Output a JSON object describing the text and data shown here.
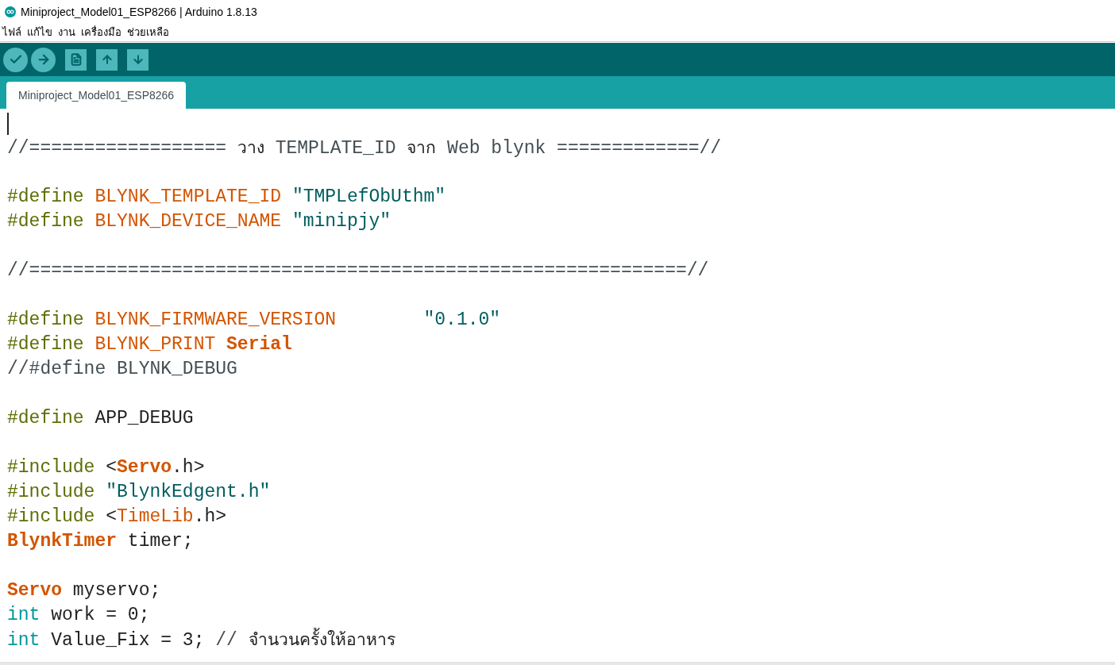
{
  "window": {
    "title": "Miniproject_Model01_ESP8266 | Arduino 1.8.13"
  },
  "menu": [
    "ไฟล์",
    "แก้ไข",
    "งาน",
    "เครื่องมือ",
    "ช่วยเหลือ"
  ],
  "toolbar": [
    {
      "kind": "verify"
    },
    {
      "kind": "upload"
    },
    {
      "kind": "new"
    },
    {
      "kind": "open"
    },
    {
      "kind": "save"
    }
  ],
  "tabs": [
    {
      "label": "Miniproject_Model01_ESP8266",
      "selected": true
    }
  ],
  "editor": {
    "lines": [
      {
        "kind": "blank"
      },
      {
        "kind": "code",
        "tokens": [
          {
            "kind": "comment",
            "text": "//================== "
          },
          {
            "kind": "thai",
            "text": "วาง"
          },
          {
            "kind": "comment",
            "text": " TEMPLATE_ID "
          },
          {
            "kind": "thai",
            "text": "จาก"
          },
          {
            "kind": "comment",
            "text": " Web blynk =============//"
          }
        ]
      },
      {
        "kind": "blank"
      },
      {
        "kind": "code",
        "tokens": [
          {
            "kind": "directive",
            "text": "#define "
          },
          {
            "kind": "macro",
            "text": "BLYNK_TEMPLATE_ID "
          },
          {
            "kind": "string",
            "text": "\"TMPLefObUthm\""
          }
        ]
      },
      {
        "kind": "code",
        "tokens": [
          {
            "kind": "directive",
            "text": "#define "
          },
          {
            "kind": "macro",
            "text": "BLYNK_DEVICE_NAME "
          },
          {
            "kind": "string",
            "text": "\"minipjy\""
          }
        ]
      },
      {
        "kind": "blank"
      },
      {
        "kind": "code",
        "tokens": [
          {
            "kind": "comment",
            "text": "//============================================================//"
          }
        ]
      },
      {
        "kind": "blank"
      },
      {
        "kind": "code",
        "tokens": [
          {
            "kind": "directive",
            "text": "#define "
          },
          {
            "kind": "macro",
            "text": "BLYNK_FIRMWARE_VERSION        "
          },
          {
            "kind": "string",
            "text": "\"0.1.0\""
          }
        ]
      },
      {
        "kind": "code",
        "tokens": [
          {
            "kind": "directive",
            "text": "#define "
          },
          {
            "kind": "macro",
            "text": "BLYNK_PRINT "
          },
          {
            "kind": "class",
            "text": "Serial"
          }
        ]
      },
      {
        "kind": "code",
        "tokens": [
          {
            "kind": "comment",
            "text": "//#define BLYNK_DEBUG"
          }
        ]
      },
      {
        "kind": "blank"
      },
      {
        "kind": "code",
        "tokens": [
          {
            "kind": "directive",
            "text": "#define "
          },
          {
            "kind": "plain",
            "text": "APP_DEBUG"
          }
        ]
      },
      {
        "kind": "blank"
      },
      {
        "kind": "code",
        "tokens": [
          {
            "kind": "directive",
            "text": "#include "
          },
          {
            "kind": "plain",
            "text": "<"
          },
          {
            "kind": "class",
            "text": "Servo"
          },
          {
            "kind": "plain",
            "text": ".h>"
          }
        ]
      },
      {
        "kind": "code",
        "tokens": [
          {
            "kind": "directive",
            "text": "#include "
          },
          {
            "kind": "string",
            "text": "\"BlynkEdgent.h\""
          }
        ]
      },
      {
        "kind": "code",
        "tokens": [
          {
            "kind": "directive",
            "text": "#include "
          },
          {
            "kind": "plain",
            "text": "<"
          },
          {
            "kind": "macro",
            "text": "TimeLib"
          },
          {
            "kind": "plain",
            "text": ".h>"
          }
        ]
      },
      {
        "kind": "code",
        "tokens": [
          {
            "kind": "class",
            "text": "BlynkTimer"
          },
          {
            "kind": "plain",
            "text": " timer;"
          }
        ]
      },
      {
        "kind": "blank"
      },
      {
        "kind": "code",
        "tokens": [
          {
            "kind": "class",
            "text": "Servo"
          },
          {
            "kind": "plain",
            "text": " myservo;"
          }
        ]
      },
      {
        "kind": "code",
        "tokens": [
          {
            "kind": "type",
            "text": "int"
          },
          {
            "kind": "plain",
            "text": " work = 0;"
          }
        ]
      },
      {
        "kind": "code",
        "tokens": [
          {
            "kind": "type",
            "text": "int"
          },
          {
            "kind": "plain",
            "text": " Value_Fix = 3; "
          },
          {
            "kind": "comment",
            "text": "// "
          },
          {
            "kind": "thai",
            "text": "จำนวนครั้งให้อาหาร"
          }
        ]
      }
    ]
  }
}
